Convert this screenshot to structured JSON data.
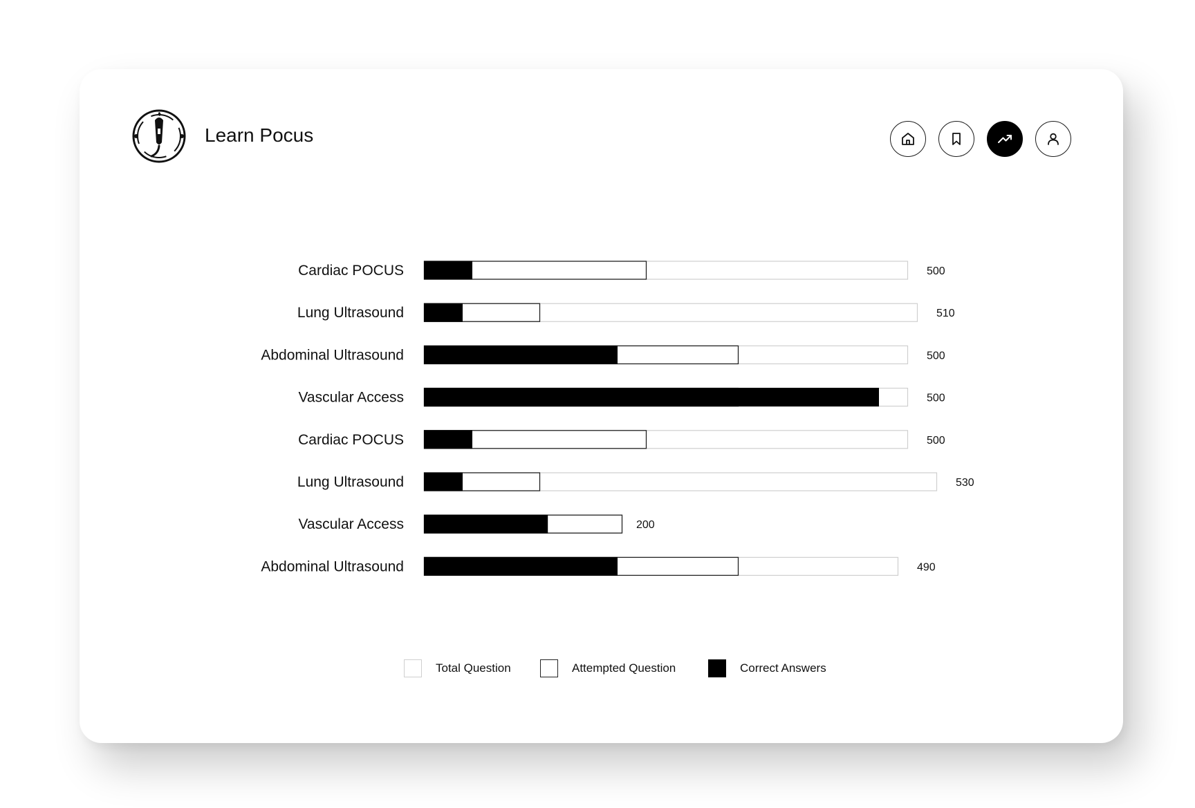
{
  "app": {
    "title": "Learn Pocus"
  },
  "nav": [
    {
      "icon": "home-icon",
      "active": false
    },
    {
      "icon": "bookmark-icon",
      "active": false
    },
    {
      "icon": "trending-up-icon",
      "active": true
    },
    {
      "icon": "user-icon",
      "active": false
    }
  ],
  "colors": {
    "correct": "#000000",
    "attempted_border": "#222222",
    "total_border": "#cfcfcf",
    "text": "#111111"
  },
  "chart_data": {
    "type": "bar",
    "orientation": "horizontal",
    "stacked": "overlapping",
    "categories": [
      "Cardiac POCUS",
      "Lung Ultrasound",
      "Abdominal Ultrasound",
      "Vascular Access",
      "Cardiac POCUS",
      "Lung Ultrasound",
      "Vascular Access",
      "Abdominal Ultrasound"
    ],
    "series": [
      {
        "name": "Total Question",
        "values": [
          500,
          510,
          500,
          500,
          500,
          530,
          200,
          490
        ]
      },
      {
        "name": "Attempted Question",
        "values": [
          230,
          120,
          325,
          325,
          230,
          120,
          205,
          325
        ]
      },
      {
        "name": "Correct Answers",
        "values": [
          50,
          40,
          200,
          470,
          50,
          40,
          128,
          200
        ]
      }
    ],
    "value_labels": [
      "500",
      "510",
      "500",
      "500",
      "500",
      "530",
      "200",
      "490"
    ],
    "legend": [
      {
        "label": "Total Question",
        "style": "light-outline"
      },
      {
        "label": "Attempted Question",
        "style": "dark-outline"
      },
      {
        "label": "Correct Answers",
        "style": "filled"
      }
    ],
    "legend_position": "bottom-center",
    "grid": false
  }
}
